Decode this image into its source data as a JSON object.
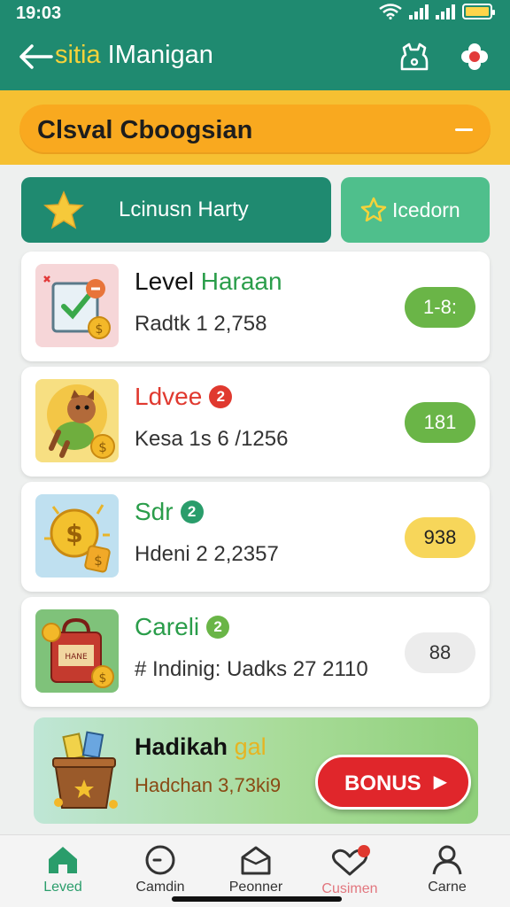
{
  "status_bar": {
    "time": "19:03"
  },
  "header": {
    "title_accent": "sitia",
    "title": "IManigan",
    "icons": [
      "arrow-left-icon",
      "bag-icon",
      "flower-icon"
    ],
    "colors": {
      "bar": "#1f8a70",
      "accent": "#f6d23a"
    }
  },
  "banner": {
    "title": "Clsval Cboogsian",
    "color": "#f6c032"
  },
  "tabs": [
    {
      "label": "Lcinusn Harty",
      "icon": "star-icon"
    },
    {
      "label": "Icedorn",
      "icon": "star-outline-icon"
    }
  ],
  "cards": [
    {
      "title": "Level",
      "title_accent": "Haraan",
      "subtitle": "Radtk 1 2,758",
      "badge": "",
      "value": "1-8:",
      "icon": "checklist-icon",
      "pill_color": "#6ab547"
    },
    {
      "title": "Ldvee",
      "title_accent": "",
      "subtitle": "Kesa 1s 6 /1256",
      "badge": "2",
      "value": "181",
      "icon": "dog-icon",
      "pill_color": "#6ab547"
    },
    {
      "title": "Sdr",
      "title_accent": "",
      "subtitle": "Hdeni 2 2,2357",
      "badge": "2",
      "value": "938",
      "icon": "coin-icon",
      "pill_color": "#f7d65a"
    },
    {
      "title": "Careli",
      "title_accent": "",
      "subtitle": "# Indinig: Uadks 27 2110",
      "badge": "2",
      "value": "88",
      "icon": "money-bag-icon",
      "pill_color": "#ececec"
    }
  ],
  "bonus": {
    "title": "Hadikah",
    "title_accent": "gal",
    "subtitle": "Hadchan 3,73ki9",
    "button": "BONUS",
    "icon": "treasure-bucket-icon"
  },
  "bottom_nav": [
    {
      "label": "Leved",
      "icon": "home-icon",
      "color": "#2a9d6b"
    },
    {
      "label": "Camdin",
      "icon": "clock-icon",
      "color": "#333333"
    },
    {
      "label": "Peonner",
      "icon": "house-outline-icon",
      "color": "#333333"
    },
    {
      "label": "Cusimen",
      "icon": "heart-message-icon",
      "color": "#e2767e"
    },
    {
      "label": "Carne",
      "icon": "person-icon",
      "color": "#333333"
    }
  ]
}
